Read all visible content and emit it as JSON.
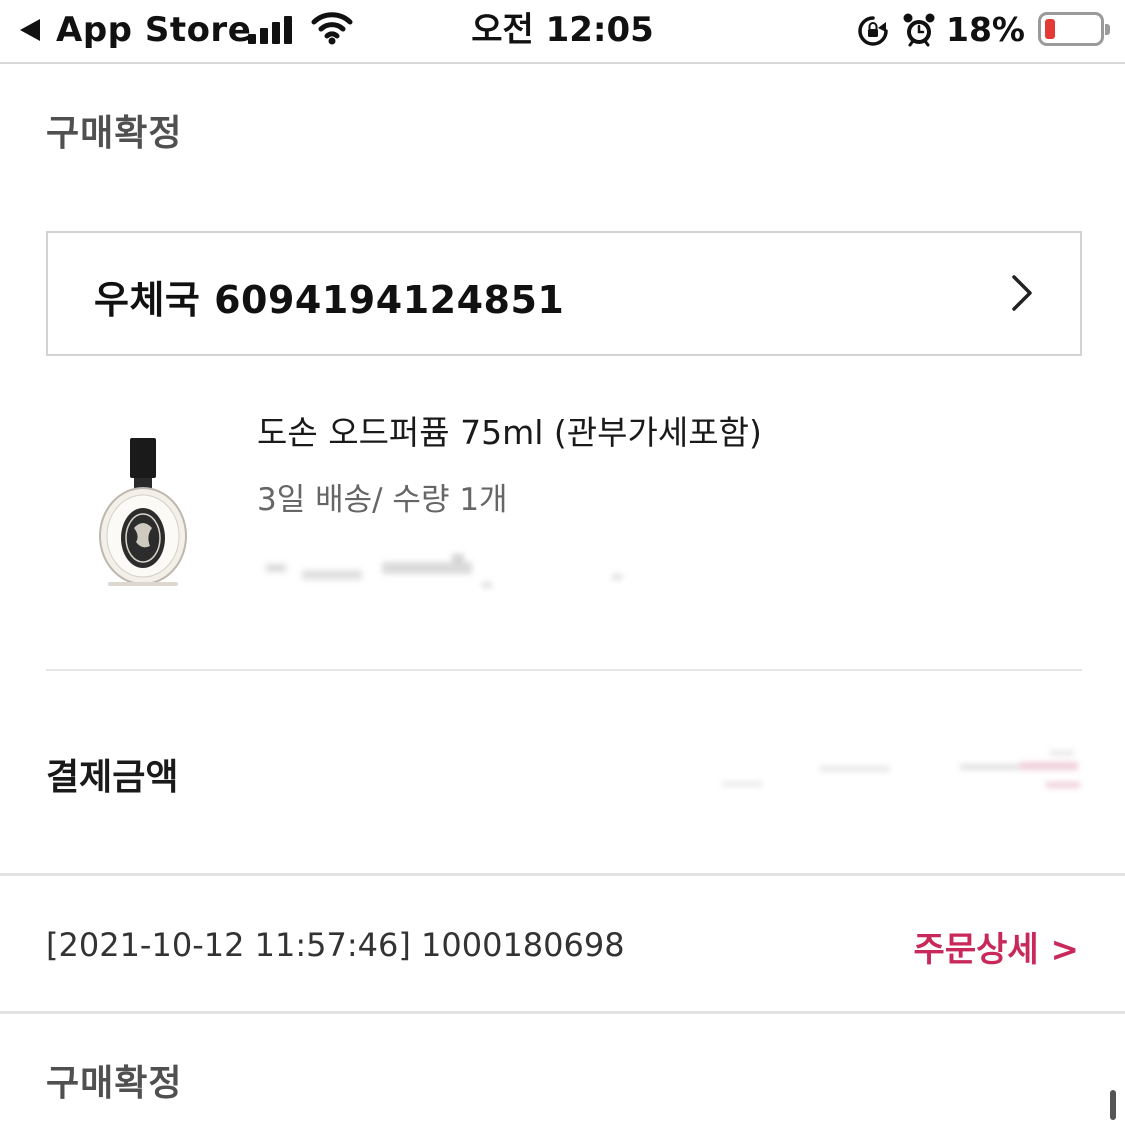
{
  "status_bar": {
    "back_label": "App Store",
    "time": "오전 12:05",
    "battery_percent": "18%",
    "battery_level": 0.18,
    "icons": [
      "back-arrow-icon",
      "cellular-signal-icon",
      "wifi-icon",
      "rotation-lock-icon",
      "alarm-icon",
      "battery-icon"
    ]
  },
  "order": {
    "status_title": "구매확정",
    "tracking": "우체국 6094194124851",
    "product": {
      "name": "도손 오드퍼퓸 75ml (관부가세포함)",
      "meta": "3일 배송/ 수량 1개"
    },
    "payment_label": "결제금액",
    "order_info": "[2021-10-12 11:57:46] 1000180698",
    "detail_link": "주문상세 >"
  },
  "next_order": {
    "status_title": "구매확정"
  },
  "colors": {
    "accent": "#c8285a",
    "battery_low": "#e53935",
    "divider": "#e3e3e3"
  }
}
